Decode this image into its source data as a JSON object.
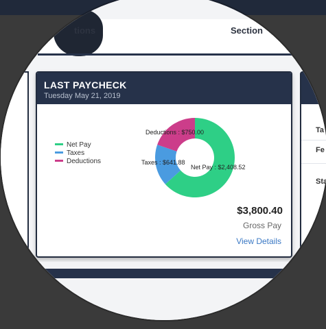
{
  "header_strip": {
    "left_text": "tions",
    "right_text": "Section"
  },
  "card": {
    "title": "LAST PAYCHECK",
    "date": "Tuesday May 21, 2019",
    "legend": [
      {
        "label": "Net Pay",
        "color": "#2ecf86"
      },
      {
        "label": "Taxes",
        "color": "#4a9be0"
      },
      {
        "label": "Deductions",
        "color": "#cc3d8a"
      }
    ],
    "slices": [
      {
        "name": "Net Pay",
        "label": "Net Pay : $2,408.52",
        "value": 2408.52,
        "color": "#2ecf86"
      },
      {
        "name": "Taxes",
        "label": "Taxes : $641.88",
        "value": 641.88,
        "color": "#4a9be0"
      },
      {
        "name": "Deductions",
        "label": "Deductions : $750.00",
        "value": 750.0,
        "color": "#cc3d8a"
      }
    ],
    "gross_amount": "$3,800.40",
    "gross_label": "Gross Pay",
    "view_details": "View Details"
  },
  "right_card": {
    "rows": [
      "Ta",
      "Fe",
      "Sta"
    ]
  }
}
